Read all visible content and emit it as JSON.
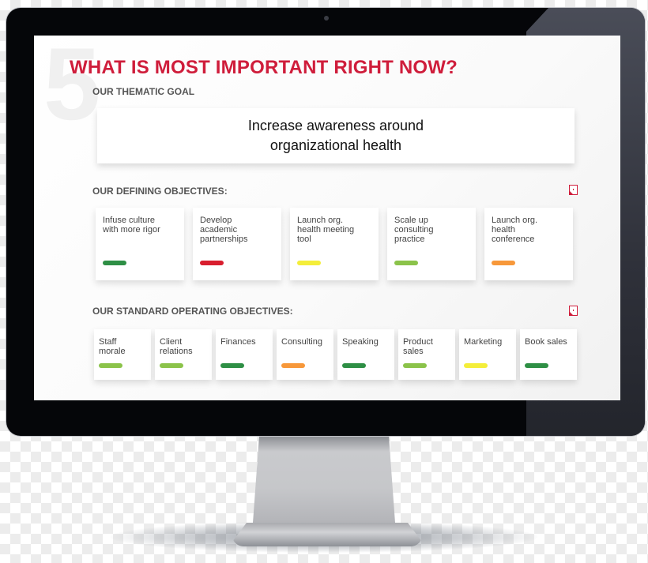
{
  "screen": {
    "big_number": "5",
    "title": "WHAT IS MOST IMPORTANT RIGHT NOW?",
    "thematic_goal": {
      "label": "OUR THEMATIC GOAL",
      "text_line1": "Increase awareness around",
      "text_line2": "organizational health"
    },
    "defining_objectives": {
      "label": "OUR DEFINING OBJECTIVES:",
      "icon": "report-icon",
      "items": [
        {
          "label": "Infuse culture\nwith more rigor",
          "status_color": "#2e8f45"
        },
        {
          "label": "Develop\nacademic\npartnerships",
          "status_color": "#d81e2e"
        },
        {
          "label": "Launch org.\nhealth meeting\ntool",
          "status_color": "#f4ee3a"
        },
        {
          "label": "Scale up\nconsulting\npractice",
          "status_color": "#8bc34a"
        },
        {
          "label": "Launch org.\nhealth\nconference",
          "status_color": "#f7983a"
        }
      ]
    },
    "standard_objectives": {
      "label": "OUR STANDARD OPERATING OBJECTIVES:",
      "icon": "report-icon",
      "items": [
        {
          "label": "Staff\nmorale",
          "status_color": "#8bc34a"
        },
        {
          "label": "Client\nrelations",
          "status_color": "#8bc34a"
        },
        {
          "label": "Finances",
          "status_color": "#2e8f45"
        },
        {
          "label": "Consulting",
          "status_color": "#f7983a"
        },
        {
          "label": "Speaking",
          "status_color": "#2e8f45"
        },
        {
          "label": "Product\nsales",
          "status_color": "#8bc34a"
        },
        {
          "label": "Marketing",
          "status_color": "#f4ee3a"
        },
        {
          "label": "Book sales",
          "status_color": "#2e8f45"
        }
      ]
    }
  },
  "colors": {
    "accent": "#cf1d3b",
    "bezel": "#050609"
  }
}
